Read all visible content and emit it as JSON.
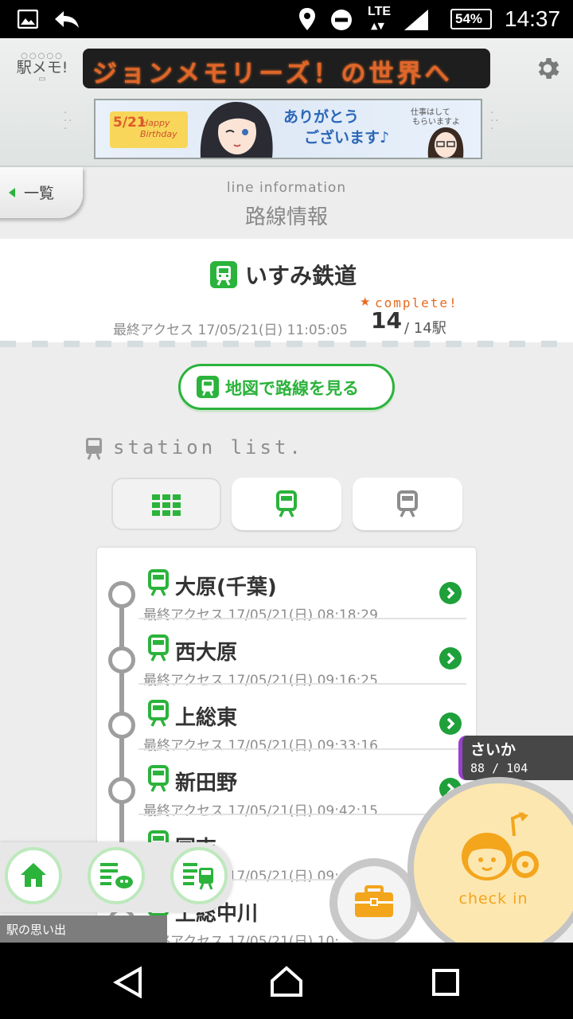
{
  "status_bar": {
    "network": "LTE",
    "battery": "54%",
    "time": "14:37"
  },
  "header": {
    "app_logo": "駅メモ!",
    "ticker_text": "ジョンメモリーズ！の世界へ",
    "banner": {
      "date": "5/21",
      "line1": "Happy",
      "line2": "Birthday",
      "thanks_1": "ありがとう",
      "thanks_2": "ございます♪",
      "side_1": "仕事はして",
      "side_2": "もらいますよ"
    }
  },
  "page": {
    "back_label": "一覧",
    "subtitle": "line information",
    "title": "路線情報"
  },
  "line": {
    "name": "いすみ鉄道",
    "last_access": "最終アクセス 17/05/21(日) 11:05:05",
    "complete_label": "complete!",
    "count": "14",
    "total": "/ 14駅"
  },
  "map_button_label": "地図で路線を見る",
  "station_list_heading": "station list.",
  "filter_tabs": [
    "grid-icon",
    "train-green-icon",
    "train-gray-icon"
  ],
  "stations": [
    {
      "name": "大原(千葉)",
      "time": "最終アクセス 17/05/21(日) 08:18:29"
    },
    {
      "name": "西大原",
      "time": "最終アクセス 17/05/21(日) 09:16:25"
    },
    {
      "name": "上総東",
      "time": "最終アクセス 17/05/21(日) 09:33:16"
    },
    {
      "name": "新田野",
      "time": "最終アクセス 17/05/21(日) 09:42:15"
    },
    {
      "name": "国吉",
      "time": "最終アクセス 17/05/21(日) 09:4"
    },
    {
      "name": "上総中川",
      "time": "最終アクセス 17/05/21(日) 10:"
    }
  ],
  "user_badge": {
    "name": "さいか",
    "progress": "88 / 104"
  },
  "bottom": {
    "memories_label": "駅の思い出",
    "checkin_label": "check in"
  },
  "colors": {
    "accent_green": "#2bb33b",
    "checkin_orange": "#f3a51c",
    "badge_purple": "#9a3fd1"
  }
}
